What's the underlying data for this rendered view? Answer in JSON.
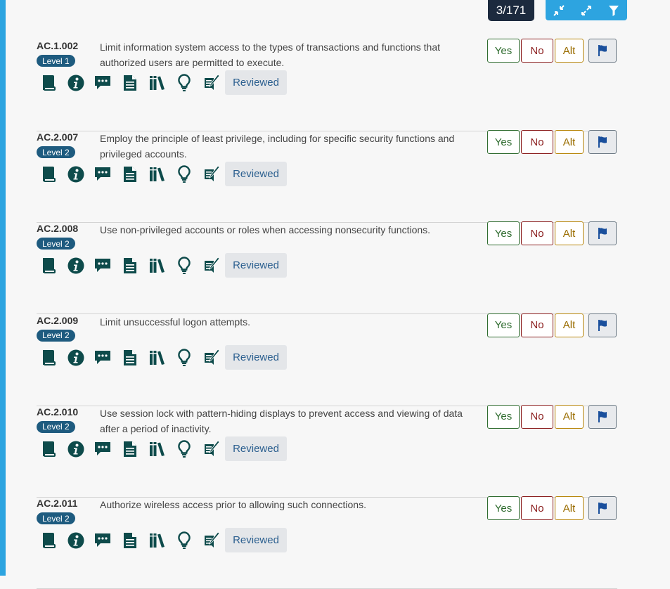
{
  "header": {
    "counter": "3/171",
    "tools": [
      {
        "name": "collapse-all-icon"
      },
      {
        "name": "expand-all-icon"
      },
      {
        "name": "filter-icon"
      }
    ]
  },
  "question_icons": [
    "book-icon",
    "info-icon",
    "comments-icon",
    "document-icon",
    "references-icon",
    "lightbulb-icon",
    "notes-icon"
  ],
  "colors": {
    "accent": "#2da4e0",
    "icon": "#0e4b4b",
    "badge": "#1e5b7f",
    "flag": "#1a4f9c"
  },
  "questions": [
    {
      "id": "AC.1.002",
      "level": "Level 1",
      "text": "Limit information system access to the types of transactions and functions that authorized users are permitted to execute.",
      "yes": "Yes",
      "no": "No",
      "alt": "Alt",
      "reviewed": "Reviewed"
    },
    {
      "id": "AC.2.007",
      "level": "Level 2",
      "text": "Employ the principle of least privilege, including for specific security functions and privileged accounts.",
      "yes": "Yes",
      "no": "No",
      "alt": "Alt",
      "reviewed": "Reviewed"
    },
    {
      "id": "AC.2.008",
      "level": "Level 2",
      "text": "Use non-privileged accounts or roles when accessing nonsecurity functions.",
      "yes": "Yes",
      "no": "No",
      "alt": "Alt",
      "reviewed": "Reviewed"
    },
    {
      "id": "AC.2.009",
      "level": "Level 2",
      "text": "Limit unsuccessful logon attempts.",
      "yes": "Yes",
      "no": "No",
      "alt": "Alt",
      "reviewed": "Reviewed"
    },
    {
      "id": "AC.2.010",
      "level": "Level 2",
      "text": "Use session lock with pattern-hiding displays to prevent access and viewing of data after a period of inactivity.",
      "yes": "Yes",
      "no": "No",
      "alt": "Alt",
      "reviewed": "Reviewed"
    },
    {
      "id": "AC.2.011",
      "level": "Level 2",
      "text": "Authorize wireless access prior to allowing such connections.",
      "yes": "Yes",
      "no": "No",
      "alt": "Alt",
      "reviewed": "Reviewed"
    }
  ]
}
